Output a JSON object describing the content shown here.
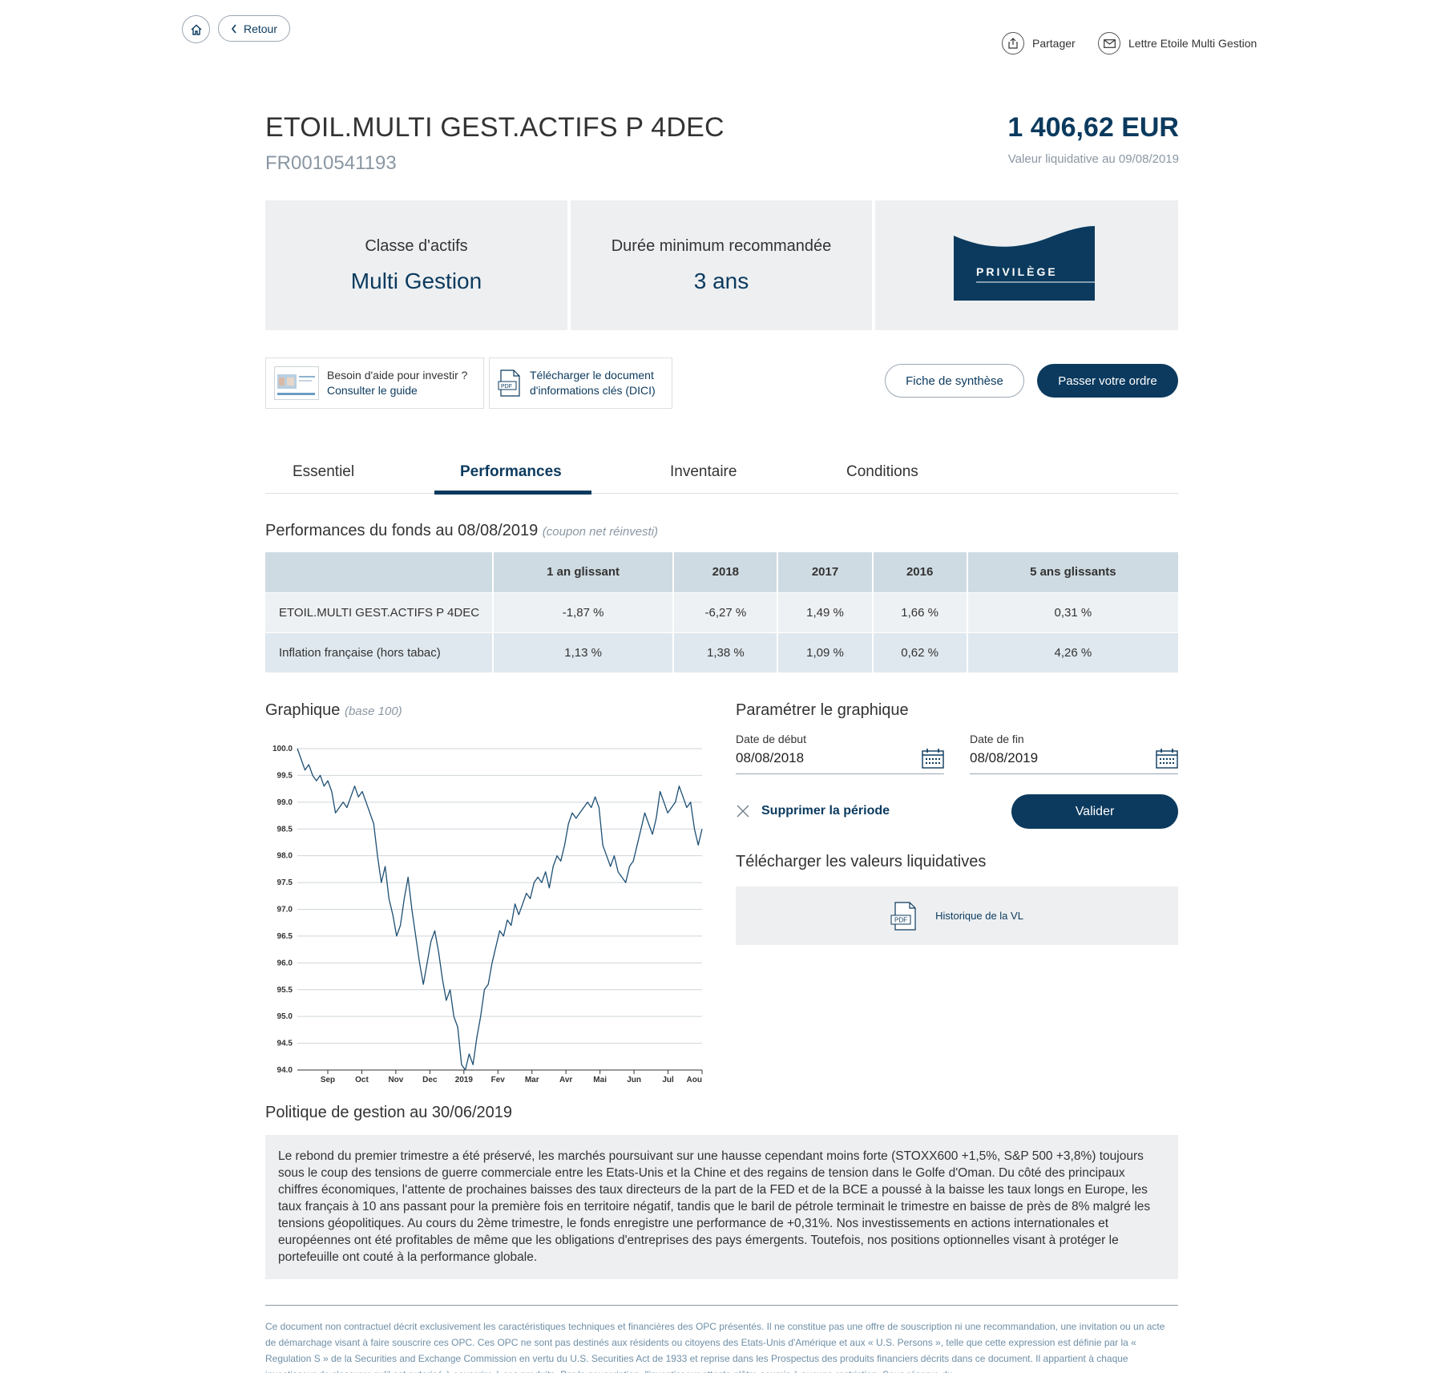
{
  "nav": {
    "back_label": "Retour",
    "share_label": "Partager",
    "newsletter_label": "Lettre Etoile Multi Gestion"
  },
  "fund": {
    "name": "ETOIL.MULTI GEST.ACTIFS P 4DEC",
    "isin": "FR0010541193",
    "price": "1 406,62 EUR",
    "price_date": "Valeur liquidative au 09/08/2019"
  },
  "info": {
    "asset_class_label": "Classe d'actifs",
    "asset_class_value": "Multi Gestion",
    "duration_label": "Durée minimum recommandée",
    "duration_value": "3 ans",
    "badge_text": "PRIVILÈGE"
  },
  "actions": {
    "help_line1": "Besoin d'aide pour investir ?",
    "help_line2": "Consulter le guide",
    "dici_line1": "Télécharger le document",
    "dici_line2": "d'informations clés (DICI)",
    "synthesis_label": "Fiche de synthèse",
    "order_label": "Passer votre ordre"
  },
  "tabs": [
    "Essentiel",
    "Performances",
    "Inventaire",
    "Conditions"
  ],
  "performance": {
    "title": "Performances du fonds au 08/08/2019",
    "subtitle": "(coupon net réinvesti)",
    "columns": [
      "1 an glissant",
      "2018",
      "2017",
      "2016",
      "5 ans glissants"
    ],
    "rows": [
      {
        "name": "ETOIL.MULTI GEST.ACTIFS P 4DEC",
        "values": [
          "-1,87 %",
          "-6,27 %",
          "1,49 %",
          "1,66 %",
          "0,31 %"
        ]
      },
      {
        "name": "Inflation française (hors tabac)",
        "values": [
          "1,13 %",
          "1,38 %",
          "1,09 %",
          "0,62 %",
          "4,26 %"
        ]
      }
    ]
  },
  "chart_section": {
    "title": "Graphique",
    "subtitle": "(base 100)"
  },
  "chart_data": {
    "type": "line",
    "ylim": [
      94.0,
      100.0
    ],
    "y_ticks": [
      "100.0",
      "99.5",
      "99.0",
      "98.5",
      "98.0",
      "97.5",
      "97.0",
      "96.5",
      "96.0",
      "95.5",
      "95.0",
      "94.5",
      "94.0"
    ],
    "x_ticks": [
      "Sep",
      "Oct",
      "Nov",
      "Dec",
      "2019",
      "Fev",
      "Mar",
      "Avr",
      "Mai",
      "Jun",
      "Jul",
      "Aou"
    ],
    "grid": true,
    "series": [
      {
        "values": [
          100.0,
          99.8,
          99.6,
          99.7,
          99.5,
          99.4,
          99.5,
          99.3,
          99.4,
          99.2,
          98.8,
          98.9,
          99.0,
          98.9,
          99.1,
          99.3,
          99.1,
          99.2,
          99.0,
          98.8,
          98.6,
          98.0,
          97.5,
          97.8,
          97.2,
          96.9,
          96.5,
          96.7,
          97.2,
          97.6,
          97.0,
          96.5,
          96.0,
          95.6,
          96.0,
          96.4,
          96.6,
          96.2,
          95.7,
          95.3,
          95.5,
          95.0,
          94.8,
          94.1,
          94.0,
          94.3,
          94.1,
          94.6,
          95.0,
          95.5,
          95.6,
          96.0,
          96.3,
          96.6,
          96.5,
          96.8,
          96.7,
          97.1,
          96.9,
          97.1,
          97.3,
          97.2,
          97.5,
          97.6,
          97.5,
          97.7,
          97.4,
          97.8,
          98.0,
          97.9,
          98.2,
          98.6,
          98.8,
          98.7,
          98.8,
          98.9,
          99.0,
          98.9,
          99.1,
          98.9,
          98.2,
          98.0,
          97.8,
          98.0,
          97.7,
          97.6,
          97.5,
          97.8,
          97.9,
          98.2,
          98.5,
          98.8,
          98.6,
          98.4,
          98.7,
          99.2,
          99.0,
          98.8,
          98.9,
          99.0,
          99.3,
          99.1,
          98.9,
          99.0,
          98.5,
          98.2,
          98.5
        ]
      }
    ]
  },
  "settings": {
    "title": "Paramétrer le graphique",
    "start_label": "Date de début",
    "start_value": "08/08/2018",
    "end_label": "Date de fin",
    "end_value": "08/08/2019",
    "remove_label": "Supprimer la période",
    "validate_label": "Valider"
  },
  "downloads": {
    "title": "Télécharger les valeurs liquidatives",
    "link_label": "Historique de la VL"
  },
  "policy": {
    "title": "Politique de gestion au 30/06/2019",
    "text": "Le rebond du premier trimestre a été préservé, les marchés poursuivant sur une hausse cependant moins forte (STOXX600 +1,5%, S&P 500 +3,8%) toujours sous le coup des tensions de guerre commerciale entre les Etats-Unis et la Chine et des regains de tension dans le Golfe d'Oman. Du côté des principaux chiffres économiques, l'attente de prochaines baisses des taux directeurs de la part de la FED et de la BCE a poussé à la baisse les taux longs en Europe, les taux français à 10 ans passant pour la première fois en territoire négatif, tandis que le baril de pétrole terminait le trimestre en baisse de près de 8% malgré les tensions géopolitiques. Au cours du 2ème trimestre, le fonds enregistre une performance de +0,31%. Nos investissements en actions internationales et européennes ont été profitables de même que les obligations d'entreprises des pays émergents. Toutefois, nos positions optionnelles visant à protéger le portefeuille ont couté à la performance globale."
  },
  "disclaimer": "Ce document non contractuel décrit exclusivement les caractéristiques techniques et financières des OPC présentés. Il ne constitue pas une offre de souscription ni une recommandation, une invitation ou un acte de démarchage visant à faire souscrire ces OPC. Ces OPC ne sont pas destinés aux résidents ou citoyens des Etats-Unis d'Amérique et aux « U.S. Persons », telle que cette expression est définie par la « Regulation S » de la Securities and Exchange Commission en vertu du U.S. Securities Act de 1933 et reprise dans les Prospectus des produits financiers décrits dans ce document. Il appartient à chaque investisseur de s'assurer qu'il est autorisé à souscrire à ces produits. Par la souscription, l'investisseur atteste n'être soumis à aucune restriction. Sous réserve du"
}
